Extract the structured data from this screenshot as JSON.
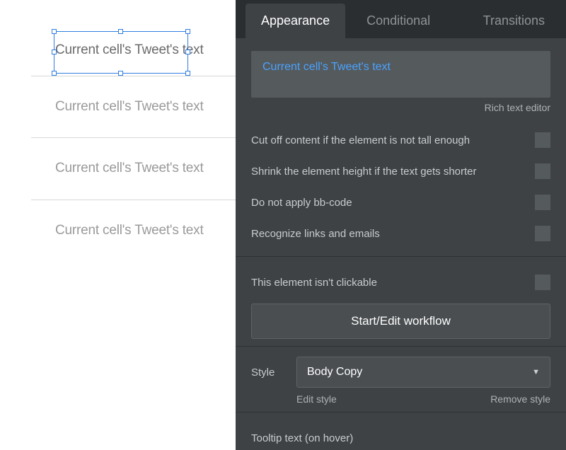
{
  "canvas": {
    "cells": [
      {
        "text": "Current cell's Tweet's text",
        "selected": true
      },
      {
        "text": "Current cell's Tweet's text"
      },
      {
        "text": "Current cell's Tweet's text"
      },
      {
        "text": "Current cell's Tweet's text"
      }
    ]
  },
  "inspector": {
    "tabs": [
      {
        "label": "Appearance",
        "active": true
      },
      {
        "label": "Conditional"
      },
      {
        "label": "Transitions"
      }
    ],
    "expression": "Current cell's Tweet's text",
    "rich_text_link": "Rich text editor",
    "options": {
      "cut_off": "Cut off content if the element is not tall enough",
      "shrink": "Shrink the element height if the text gets shorter",
      "no_bbcode": "Do not apply bb-code",
      "recognize_links": "Recognize links and emails"
    },
    "clickable_label": "This element isn't clickable",
    "workflow_button": "Start/Edit workflow",
    "style": {
      "label": "Style",
      "selected": "Body Copy",
      "edit": "Edit style",
      "remove": "Remove style"
    },
    "tooltip_label": "Tooltip text (on hover)"
  }
}
